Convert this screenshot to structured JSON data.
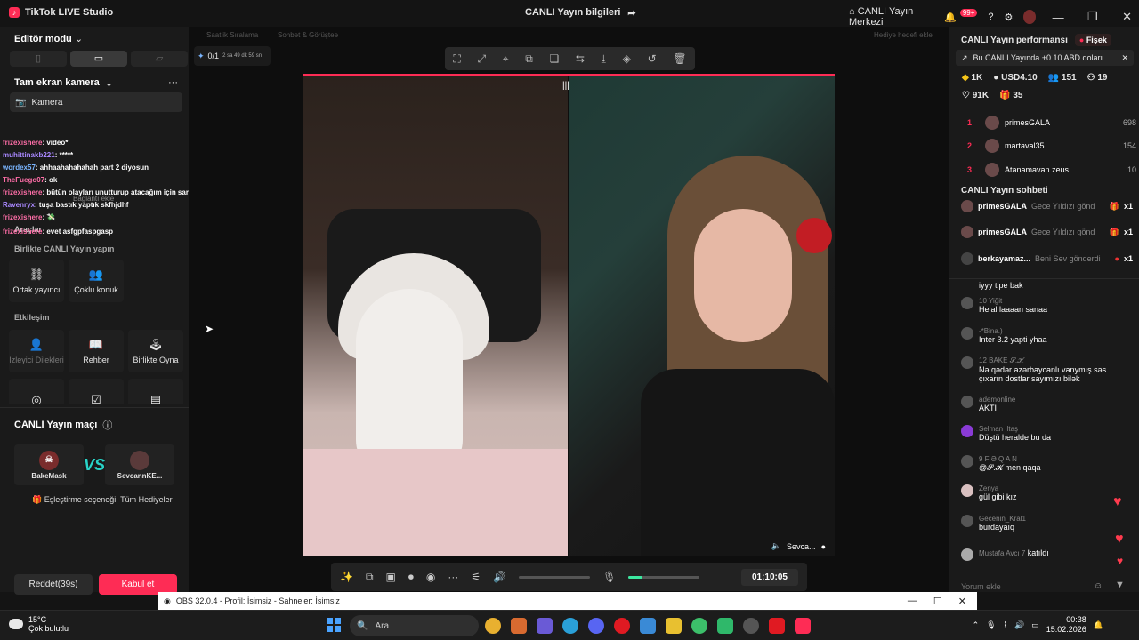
{
  "titlebar": {
    "app_name": "TikTok LIVE Studio",
    "center_title": "CANLI Yayın bilgileri",
    "live_center": "CANLI Yayın Merkezi",
    "notif_badge": "99+"
  },
  "left": {
    "editor_mode": "Editör modu",
    "camera_section": "Tam ekran kamera",
    "camera_item": "Kamera",
    "tools_label": "Araçlar",
    "together_label": "Birlikte CANLI Yayın yapın",
    "cohost": "Ortak yayıncı",
    "multiguest": "Çoklu konuk",
    "interaction_label": "Etkileşim",
    "viewer_requests": "İzleyici Dilekleri",
    "guide": "Rehber",
    "play_together": "Birlikte Oyna",
    "battle_title": "CANLI Yayın maçı",
    "player1": "BakeMask",
    "player2": "SevcannKE...",
    "match_option": "Eşleştirme seçeneği: Tüm Hediyeler",
    "reject": "Reddet(39s)",
    "accept": "Kabul et",
    "overlay_hint": "Bağlantı ekle"
  },
  "overlay_chat": [
    {
      "user": "frizexishere",
      "msg": ": video*"
    },
    {
      "user": "muhittinakb221",
      "msg": ": *****"
    },
    {
      "user": "wordex57",
      "msg": ": ahhaahahahahah part 2 diyosun"
    },
    {
      "user": "TheFuego07",
      "msg": ": ok"
    },
    {
      "user": "frizexishere",
      "msg": ": bütün olayları unutturup atacağım için saracak"
    },
    {
      "user": "Ravenryx",
      "msg": ": tuşa bastık yaptık skfhjdhf"
    },
    {
      "user": "frizexishere",
      "msg": ": 💸"
    },
    {
      "user": "frizexishere",
      "msg": ": evet asfgpfaspgasp"
    }
  ],
  "center": {
    "mini_left": "Saatlik Sıralama",
    "mini_mid": "Sohbet & Görüştee",
    "mini_right": "Hediye hedefi ekle",
    "goal": "0/1",
    "goal_time": "2 sa 49 dk 59 sn",
    "guest_name": "Sevca...",
    "timer": "01:10:05",
    "mic_level": 0.2
  },
  "right": {
    "perf_title": "CANLI Yayın performansı",
    "fisek": "Fişek",
    "promo": "Bu CANLI Yayında +0.10 ABD doları",
    "stats1": [
      "1K",
      "USD4.10",
      "151",
      "19"
    ],
    "stats2": [
      "91K",
      "35"
    ],
    "ranks": [
      {
        "n": "1",
        "name": "primesGALA",
        "score": "698"
      },
      {
        "n": "2",
        "name": "martaval35",
        "score": "154"
      },
      {
        "n": "3",
        "name": "Atanamavan zeus",
        "score": "10"
      }
    ],
    "chat_title": "CANLI Yayın sohbeti",
    "gifts": [
      {
        "name": "primesGALA",
        "text": "Gece Yıldızı gönd",
        "count": "x1"
      },
      {
        "name": "primesGALA",
        "text": "Gece Yıldızı gönd",
        "count": "x1"
      },
      {
        "name": "berkayamaz...",
        "text": "Beni Sev gönderdi",
        "count": "x1"
      }
    ],
    "messages": [
      {
        "name": "",
        "text": "iyyy tipe bak"
      },
      {
        "name": "10 Yiğit",
        "text": "Helal laaaan sanaa"
      },
      {
        "name": "-*Bina.)",
        "text": "Inter 3.2 yapti yhaa"
      },
      {
        "name": "12 BAKE 𝓢.𝓚",
        "text": "Nə qədər azərbaycanlı vanymış səs çıxarın dostlar sayımızı bilək"
      },
      {
        "name": "ademonline",
        "text": "AKTİ"
      },
      {
        "name": "Selman İltaş",
        "text": "Düştü heralde bu da"
      },
      {
        "name": "9 F Ə Q A N",
        "text": "@𝓢.𝓚 men qaqa"
      },
      {
        "name": "Zenya",
        "text": "gül gibi kız"
      },
      {
        "name": "Gecenin_Kral1",
        "text": "burdayaıq"
      },
      {
        "name": "Mustafa Avcı 7",
        "text": "katıldı"
      }
    ],
    "comment_placeholder": "Yorum ekle"
  },
  "obs": {
    "title": "OBS 32.0.4 - Profil: İsimsiz - Sahneler: İsimsiz"
  },
  "taskbar": {
    "temp": "15°C",
    "weather": "Çok bulutlu",
    "search": "Ara",
    "time": "00:38",
    "date": "15.02.2026"
  }
}
